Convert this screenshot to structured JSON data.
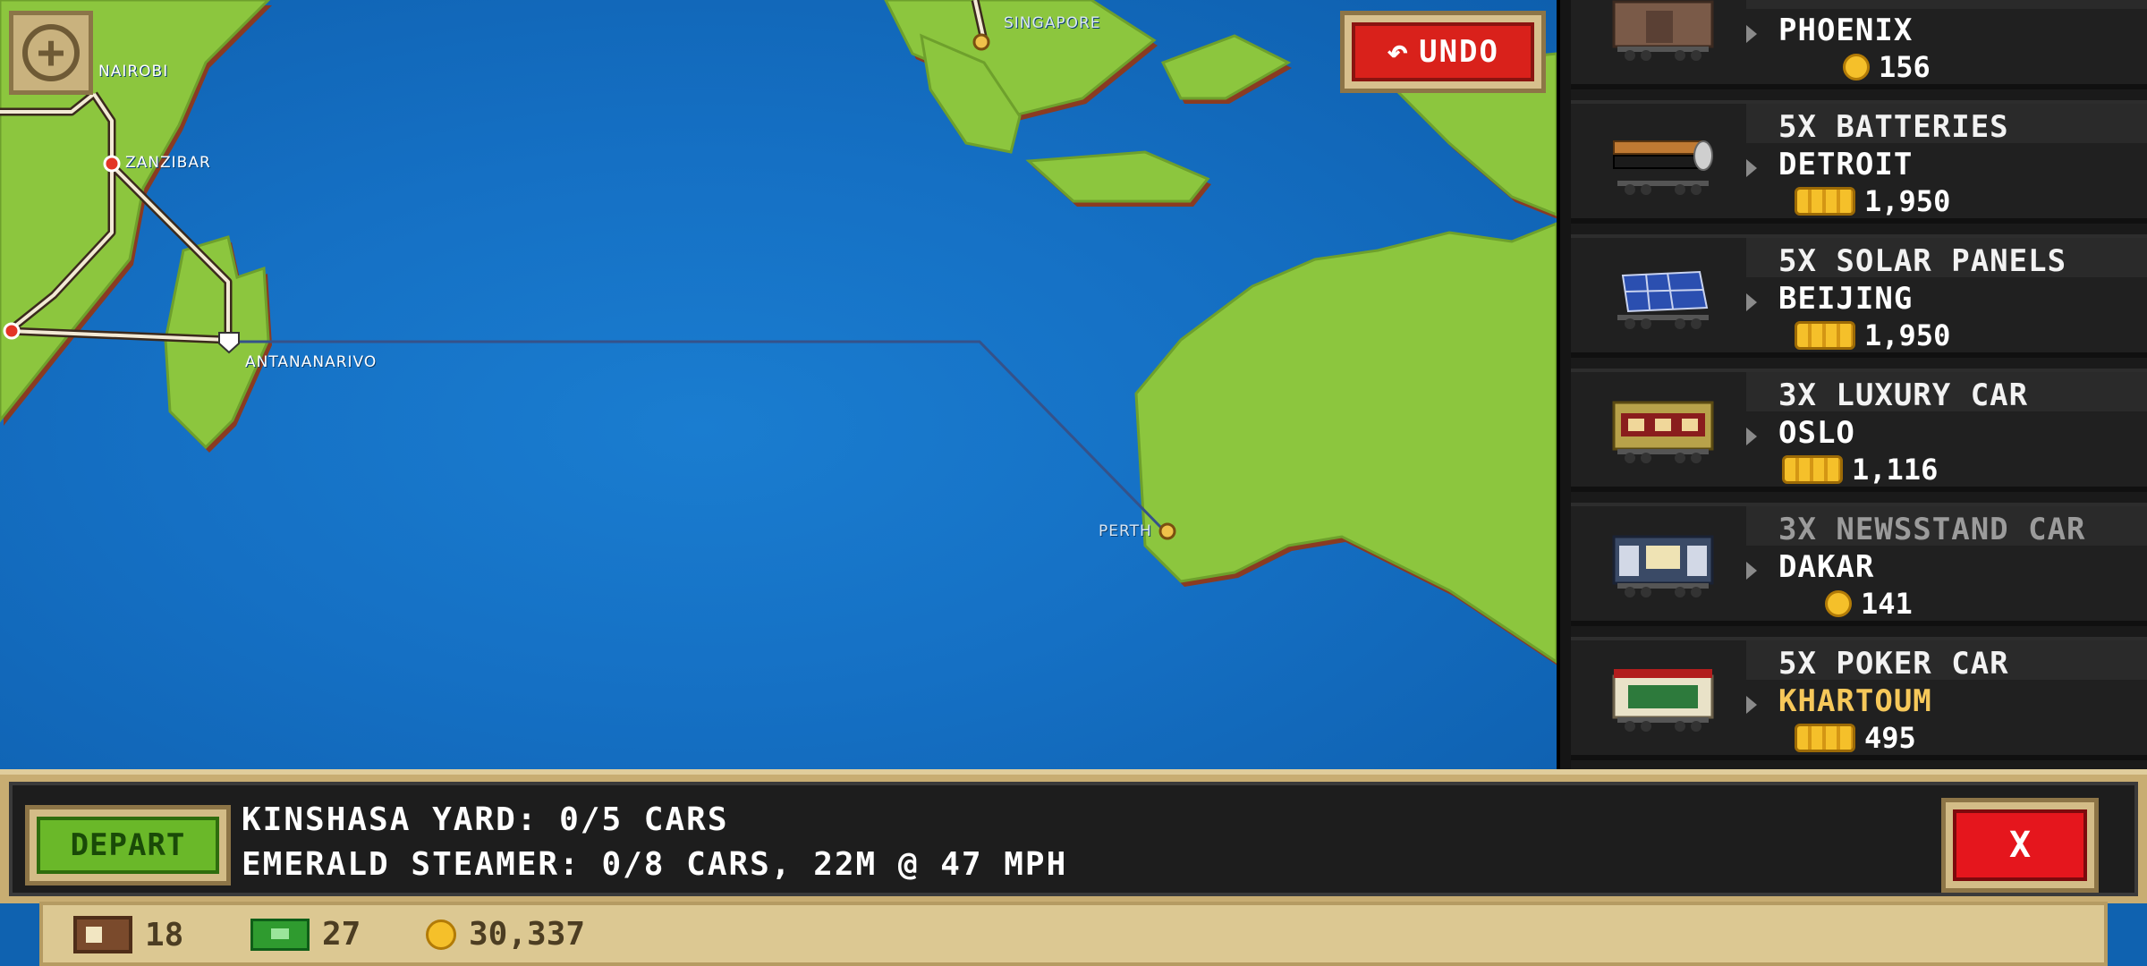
{
  "map": {
    "cities": {
      "nairobi": "NAIROBI",
      "zanzibar": "ZANZIBAR",
      "antananarivo": "ANTANANARIVO",
      "singapore": "SINGAPORE",
      "perth": "PERTH"
    },
    "zoom_icon": "plus-icon",
    "undo_label": "UNDO"
  },
  "cargo": [
    {
      "qty": "",
      "dest": "PHOENIX",
      "price": "156",
      "coin": "single"
    },
    {
      "qty": "5X BATTERIES",
      "dest": "DETROIT",
      "price": "1,950",
      "coin": "stack"
    },
    {
      "qty": "5X SOLAR PANELS",
      "dest": "BEIJING",
      "price": "1,950",
      "coin": "stack"
    },
    {
      "qty": "3X LUXURY CAR",
      "dest": "OSLO",
      "price": "1,116",
      "coin": "stack"
    },
    {
      "qty": "3X NEWSSTAND CAR",
      "dest": "DAKAR",
      "price": "141",
      "coin": "single"
    },
    {
      "qty": "5X POKER CAR",
      "dest": "KHARTOUM",
      "price": "495",
      "coin": "stack"
    }
  ],
  "bottom": {
    "depart_label": "DEPART",
    "yard_line": "KINSHASA YARD: 0/5 CARS",
    "train_line": "EMERALD STEAMER: 0/8 CARS, 22M @ 47 MPH",
    "close_label": "X"
  },
  "status": {
    "cars": "18",
    "cash": "27",
    "coins": "30,337"
  },
  "colors": {
    "ocean": "#1570c4",
    "land": "#8cc63e",
    "cargo_dest_highlight": "#f6c85a",
    "depart_green": "#6ab829",
    "close_red": "#e5161d"
  }
}
